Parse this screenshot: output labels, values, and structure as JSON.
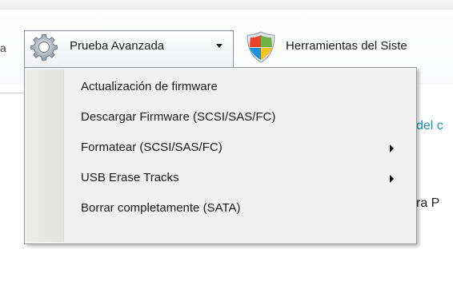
{
  "toolbar": {
    "left_cut_text": "a",
    "advanced_test_label": "Prueba Avanzada",
    "system_tools_label": "Herramientas del Siste"
  },
  "background": {
    "link_fragment": "del c",
    "text_fragment": "ra P"
  },
  "menu": {
    "items": [
      {
        "label": "Actualización de firmware",
        "has_submenu": false
      },
      {
        "label": "Descargar Firmware (SCSI/SAS/FC)",
        "has_submenu": false
      },
      {
        "label": "Formatear (SCSI/SAS/FC)",
        "has_submenu": true
      },
      {
        "label": "USB Erase Tracks",
        "has_submenu": true
      },
      {
        "label": "Borrar completamente (SATA)",
        "has_submenu": false
      }
    ]
  },
  "icons": {
    "tool1": "gear-icon",
    "tool2": "windows-shield-icon",
    "dropdown": "chevron-down-icon",
    "submenu": "chevron-right-icon"
  },
  "colors": {
    "link": "#1a8fb0",
    "menu_bg": "#f1f1f1",
    "menu_border": "#979797"
  }
}
